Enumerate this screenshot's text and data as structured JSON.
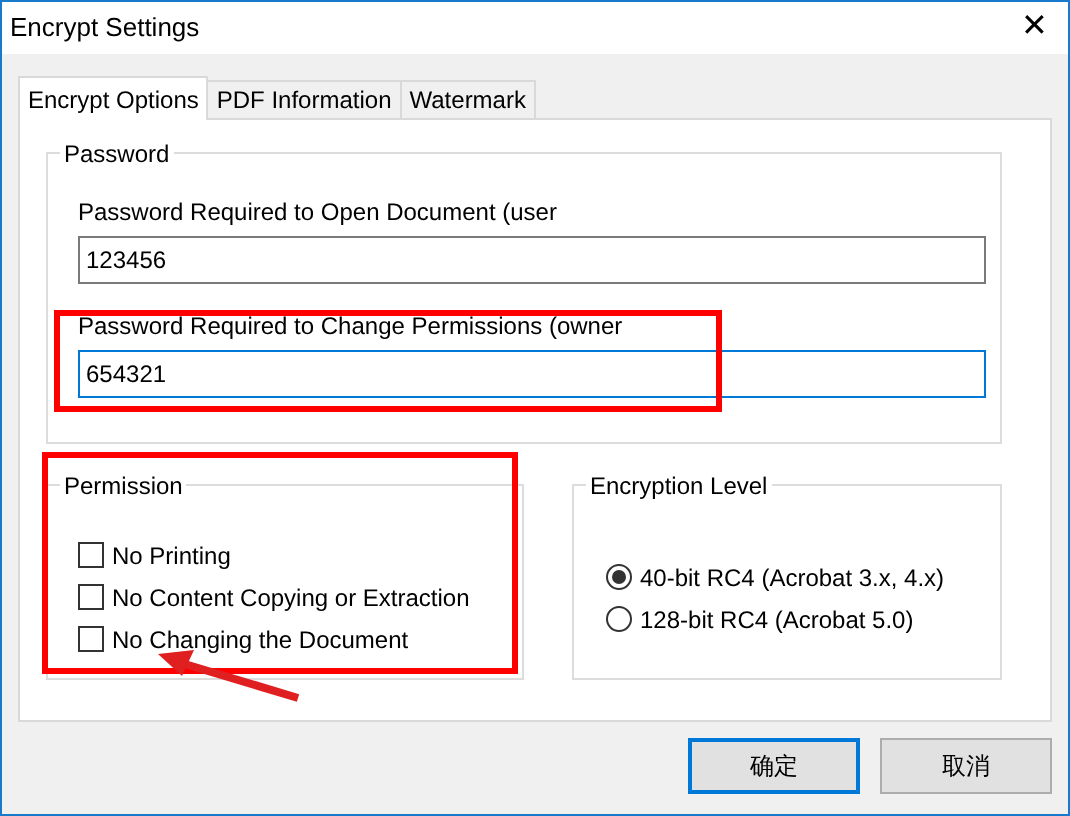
{
  "window": {
    "title": "Encrypt Settings",
    "close": "✕"
  },
  "tabs": [
    {
      "label": "Encrypt Options",
      "selected": true
    },
    {
      "label": "PDF Information",
      "selected": false
    },
    {
      "label": "Watermark",
      "selected": false
    }
  ],
  "password": {
    "title": "Password",
    "fields": [
      {
        "label": "Password Required to Open Document (user",
        "value": "123456",
        "focused": false
      },
      {
        "label": "Password Required to Change Permissions (owner",
        "value": "654321",
        "focused": true
      }
    ]
  },
  "permission": {
    "title": "Permission",
    "options": [
      {
        "label": "No Printing",
        "checked": false
      },
      {
        "label": "No Content Copying or Extraction",
        "checked": false
      },
      {
        "label": "No Changing the Document",
        "checked": false
      }
    ]
  },
  "encryption_level": {
    "title": "Encryption Level",
    "options": [
      {
        "label": "40-bit RC4 (Acrobat 3.x, 4.x)",
        "selected": true
      },
      {
        "label": "128-bit RC4 (Acrobat 5.0)",
        "selected": false
      }
    ]
  },
  "buttons": [
    {
      "label": "确定",
      "default": true
    },
    {
      "label": "取消",
      "default": false
    }
  ]
}
